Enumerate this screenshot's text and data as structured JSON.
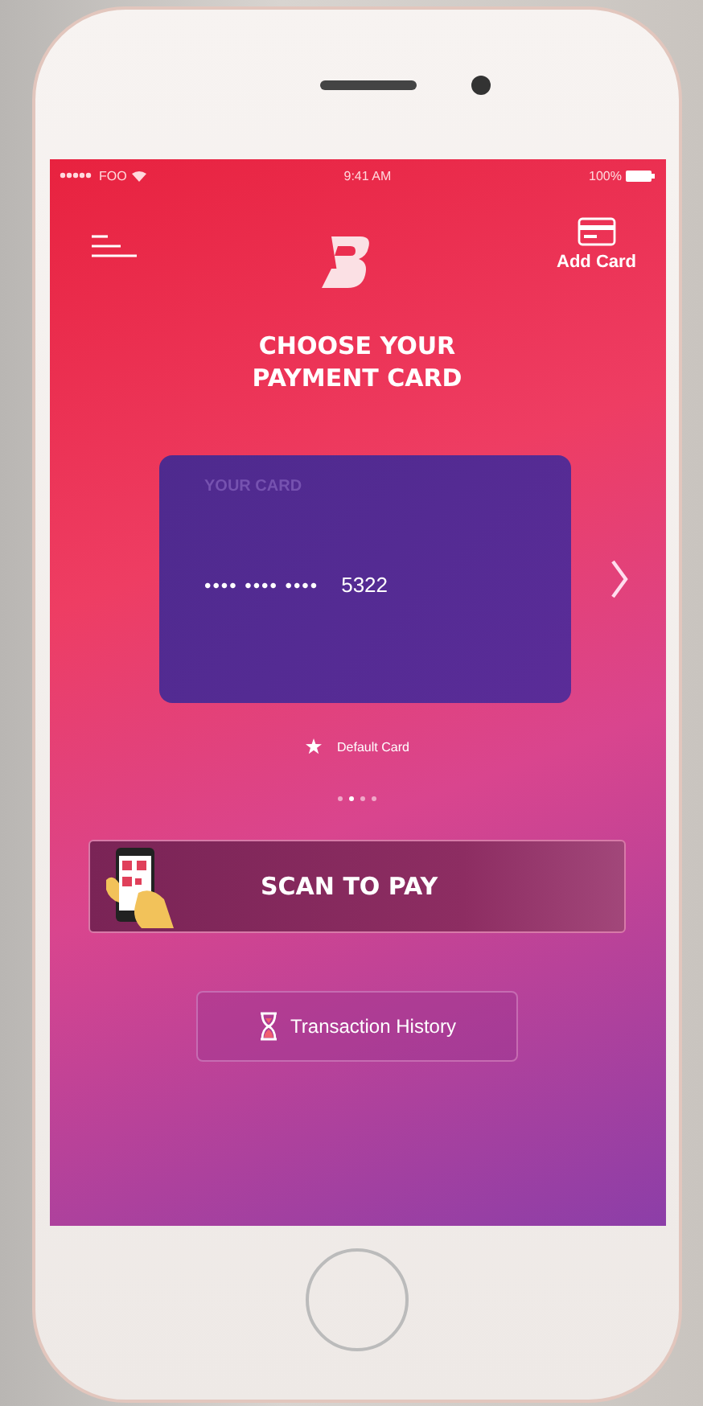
{
  "status_bar": {
    "carrier": "FOO",
    "time": "9:41 AM",
    "battery": "100%"
  },
  "header": {
    "add_card": "Add Card"
  },
  "title": "CHOOSE YOUR PAYMENT CARD",
  "card": {
    "label": "YOUR CARD",
    "masked": "•••• •••• ••••",
    "last4": "5322"
  },
  "default_label": "Default Card",
  "carousel_dots": [
    {
      "selected": false
    },
    {
      "selected": true
    },
    {
      "selected": false
    },
    {
      "selected": false
    }
  ],
  "scan_button": "SCAN TO PAY",
  "history_button": "Transaction History"
}
